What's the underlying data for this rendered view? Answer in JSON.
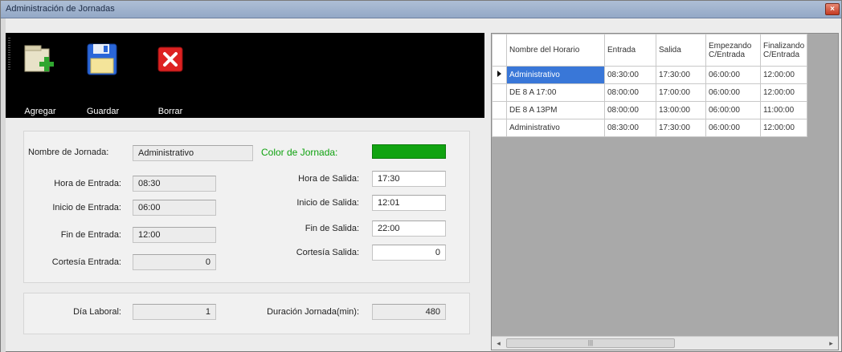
{
  "window": {
    "title": "Administración de Jornadas",
    "close_glyph": "×"
  },
  "toolbar": {
    "items": [
      {
        "label": "Agregar",
        "icon": "add-folder-icon"
      },
      {
        "label": "Guardar",
        "icon": "floppy-disk-icon"
      },
      {
        "label": "Borrar",
        "icon": "delete-x-icon"
      }
    ]
  },
  "form": {
    "nombre_label": "Nombre de Jornada:",
    "nombre_value": "Administrativo",
    "color_label": "Color de Jornada:",
    "color_value": "#11a311",
    "hora_entrada_label": "Hora de Entrada:",
    "hora_entrada_value": "08:30",
    "inicio_entrada_label": "Inicio de Entrada:",
    "inicio_entrada_value": "06:00",
    "fin_entrada_label": "Fin de Entrada:",
    "fin_entrada_value": "12:00",
    "cortesia_entrada_label": "Cortesía Entrada:",
    "cortesia_entrada_value": "0",
    "hora_salida_label": "Hora de Salida:",
    "hora_salida_value": "17:30",
    "inicio_salida_label": "Inicio de Salida:",
    "inicio_salida_value": "12:01",
    "fin_salida_label": "Fin de Salida:",
    "fin_salida_value": "22:00",
    "cortesia_salida_label": "Cortesía Salida:",
    "cortesia_salida_value": "0",
    "dia_laboral_label": "Día Laboral:",
    "dia_laboral_value": "1",
    "duracion_label": "Duración Jornada(min):",
    "duracion_value": "480"
  },
  "grid": {
    "columns": [
      "Nombre del Horario",
      "Entrada",
      "Salida",
      "Empezando C/Entrada",
      "Finalizando C/Entrada"
    ],
    "rows": [
      [
        "Administrativo",
        "08:30:00",
        "17:30:00",
        "06:00:00",
        "12:00:00"
      ],
      [
        "DE 8 A 17:00",
        "08:00:00",
        "17:00:00",
        "06:00:00",
        "12:00:00"
      ],
      [
        "DE 8 A 13PM",
        "08:00:00",
        "13:00:00",
        "06:00:00",
        "11:00:00"
      ],
      [
        "Administrativo",
        "08:30:00",
        "17:30:00",
        "06:00:00",
        "12:00:00"
      ]
    ],
    "selected_row": 0
  },
  "scrollbar": {
    "left_glyph": "◂",
    "right_glyph": "▸",
    "thumb_glyph": "|||"
  }
}
